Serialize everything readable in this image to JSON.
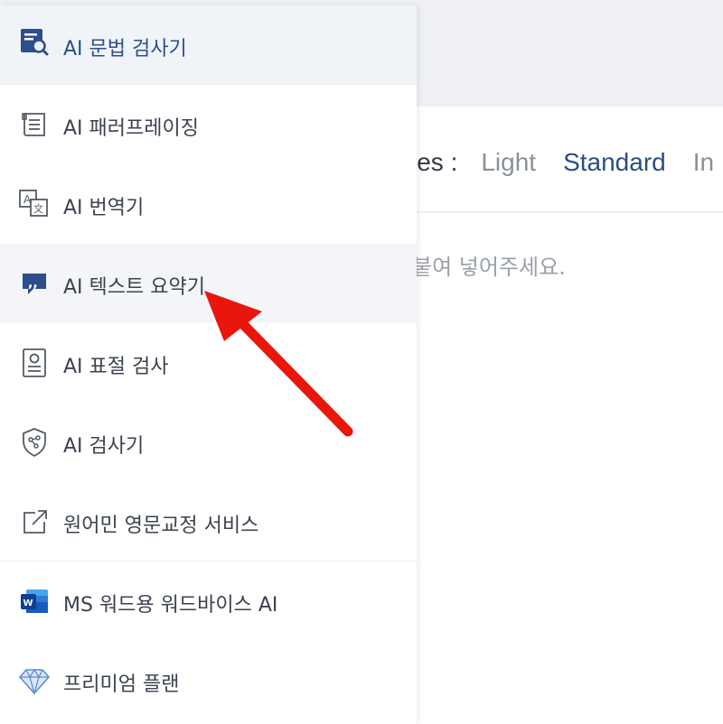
{
  "menu": {
    "items": [
      {
        "label": "AI 문법 검사기",
        "icon": "grammar-check-icon"
      },
      {
        "label": "AI 패러프레이징",
        "icon": "paraphrase-document-icon"
      },
      {
        "label": "AI 번역기",
        "icon": "translate-icon"
      },
      {
        "label": "AI 텍스트 요약기",
        "icon": "summary-chat-icon"
      },
      {
        "label": "AI 표절 검사",
        "icon": "plagiarism-certificate-icon"
      },
      {
        "label": "AI 검사기",
        "icon": "ai-shield-icon"
      },
      {
        "label": "원어민 영문교정 서비스",
        "icon": "external-link-icon"
      },
      {
        "label": "MS 워드용 워드바이스 AI",
        "icon": "ms-word-icon"
      },
      {
        "label": "프리미엄 플랜",
        "icon": "diamond-icon"
      }
    ]
  },
  "styles_bar": {
    "label": "les :",
    "options": [
      "Light",
      "Standard",
      "In"
    ]
  },
  "editor": {
    "placeholder": "붙여 넣어주세요."
  },
  "colors": {
    "accent": "#2c4f8a",
    "annotation_arrow": "#e8160c",
    "word_blue": "#2b5797"
  }
}
